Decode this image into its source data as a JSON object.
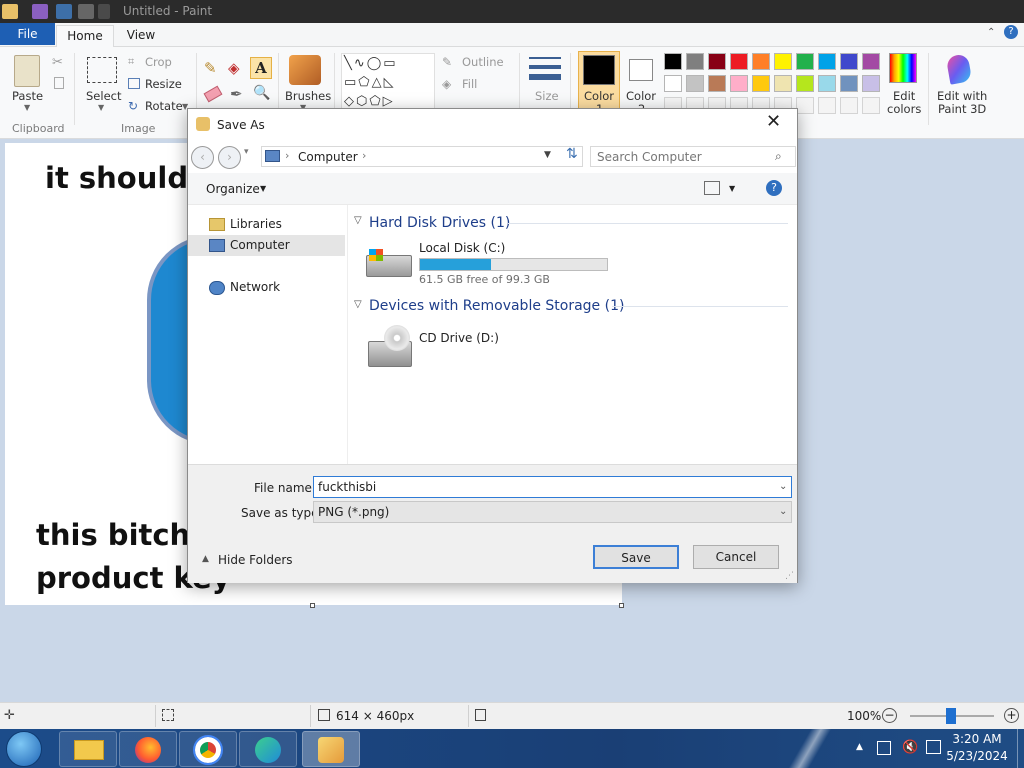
{
  "window": {
    "title": "Untitled - Paint"
  },
  "ribbon": {
    "tabs": {
      "file": "File",
      "home": "Home",
      "view": "View"
    },
    "clipboard": {
      "paste": "Paste",
      "label": "Clipboard"
    },
    "image": {
      "select": "Select",
      "crop": "Crop",
      "resize": "Resize",
      "rotate": "Rotate",
      "label": "Image"
    },
    "shapes": {
      "brushes": "Brushes",
      "outline": "Outline",
      "fill": "Fill"
    },
    "size": "Size",
    "color1": "Color\n1",
    "color2": "Color\n2",
    "color1_label": "Color",
    "color1_num": "1",
    "color2_label": "Color",
    "color2_num": "2",
    "edit_colors": [
      "Edit",
      "colors"
    ],
    "edit_paint3d": [
      "Edit with",
      "Paint 3D"
    ],
    "palette_row1": [
      "#000000",
      "#7f7f7f",
      "#880015",
      "#ed1c24",
      "#ff7f27",
      "#fff200",
      "#22b14c",
      "#00a2e8",
      "#3f48cc",
      "#a349a4"
    ],
    "palette_row2": [
      "#ffffff",
      "#c3c3c3",
      "#b97a57",
      "#ffaec9",
      "#ffc90e",
      "#efe4b0",
      "#b5e61d",
      "#99d9ea",
      "#7092be",
      "#c8bfe7"
    ]
  },
  "canvas": {
    "line1": "it shouldn",
    "line2": "this bitch d",
    "line3": "product key"
  },
  "status": {
    "dimensions": "614 × 460px",
    "zoom": "100%"
  },
  "taskbar": {
    "time": "3:20 AM",
    "date": "5/23/2024"
  },
  "dialog": {
    "title": "Save As",
    "address": "Computer",
    "search_placeholder": "Search Computer",
    "organize": "Organize",
    "nav": {
      "libraries": "Libraries",
      "computer": "Computer",
      "network": "Network"
    },
    "hdd_section": "Hard Disk Drives (1)",
    "local_disk": {
      "name": "Local Disk (C:)",
      "free": "61.5 GB free of 99.3 GB",
      "used_fraction": 0.38
    },
    "removable_section": "Devices with Removable Storage (1)",
    "cd_drive": "CD Drive (D:)",
    "file_name_label": "File name:",
    "file_name_value": "fuckthisbi",
    "save_type_label": "Save as type:",
    "save_type_value": "PNG (*.png)",
    "hide_folders": "Hide Folders",
    "save": "Save",
    "cancel": "Cancel"
  }
}
